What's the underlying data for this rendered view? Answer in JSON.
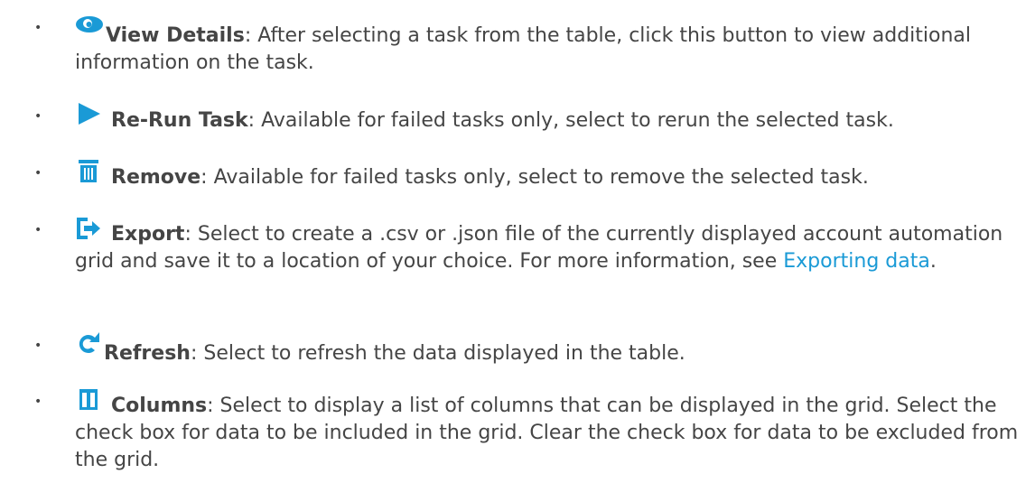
{
  "items": [
    {
      "icon": "eye-icon",
      "term": "View Details",
      "text": ": After selecting a task from the table, click this button to view additional information on the task."
    },
    {
      "icon": "play-icon",
      "term": "Re-Run Task",
      "text": ": Available for failed tasks only, select to rerun the selected task."
    },
    {
      "icon": "trash-icon",
      "term": "Remove",
      "text": ": Available for failed tasks only, select to remove the selected task."
    },
    {
      "icon": "export-icon",
      "term": "Export",
      "text": ": Select to create a .csv or .json file of the currently displayed account automation grid and save it to a location of your choice. For more information, see ",
      "link": "Exporting data",
      "after": "."
    },
    {
      "icon": "refresh-icon",
      "term": "Refresh",
      "text": ": Select to refresh the data displayed in the table."
    },
    {
      "icon": "columns-icon",
      "term": "Columns",
      "text": ": Select to display a list of columns that can be displayed in the grid. Select the check box for data to be included in the grid. Clear the check box for data to be excluded from the grid."
    }
  ],
  "colors": {
    "text": "#454545",
    "accent": "#1a9ad6",
    "link": "#1a9ad6"
  }
}
